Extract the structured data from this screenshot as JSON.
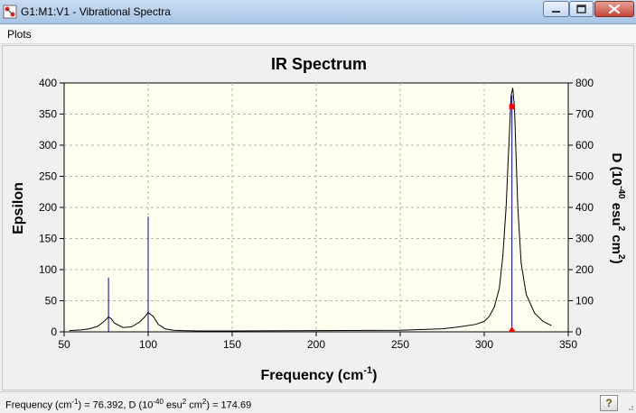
{
  "window": {
    "title": "G1:M1:V1 - Vibrational Spectra"
  },
  "menu": {
    "items": [
      "Plots"
    ]
  },
  "chart_data": {
    "type": "line",
    "title": "IR Spectrum",
    "xlabel_main": "Frequency (cm",
    "xlabel_sup": "-1",
    "xlabel_end": ")",
    "ylabel": "Epsilon",
    "y2label_parts": [
      "D (10",
      "-40",
      " esu",
      "2",
      " cm",
      "2",
      ")"
    ],
    "xlim": [
      50,
      350
    ],
    "ylim": [
      0,
      400
    ],
    "y2lim": [
      0,
      800
    ],
    "xticks": [
      50,
      100,
      150,
      200,
      250,
      300,
      350
    ],
    "yticks": [
      0,
      50,
      100,
      150,
      200,
      250,
      300,
      350,
      400
    ],
    "y2ticks": [
      0,
      100,
      200,
      300,
      400,
      500,
      600,
      700,
      800
    ],
    "grid": true,
    "series": [
      {
        "x": [
          53,
          60,
          65,
          70,
          73,
          75,
          76.4,
          78,
          80,
          85,
          90,
          95,
          98,
          100,
          103,
          106,
          110,
          115,
          120,
          130,
          150,
          200,
          250,
          275,
          285,
          295,
          300,
          303,
          306,
          309,
          311,
          313,
          314,
          315,
          316,
          317,
          318,
          319,
          320,
          322,
          325,
          330,
          335,
          340
        ],
        "y": [
          2,
          3,
          5,
          9,
          15,
          20,
          24,
          21,
          14,
          7,
          8,
          16,
          24,
          31,
          25,
          12,
          5,
          2.5,
          2,
          1.5,
          1.5,
          2,
          2.5,
          5,
          8,
          12,
          17,
          25,
          40,
          70,
          120,
          200,
          260,
          320,
          380,
          392,
          360,
          280,
          200,
          110,
          60,
          30,
          17,
          10
        ]
      }
    ],
    "sticks": [
      {
        "x": 76.4,
        "D": 174.69
      },
      {
        "x": 100,
        "D": 370
      },
      {
        "x": 316.5,
        "D": 760
      }
    ],
    "marker": {
      "x": 316.5,
      "y": 362
    },
    "colors": {
      "curve": "#000000",
      "sticks": "#0000aa",
      "marker": "#ff0000",
      "plot_bg": "#fffff0",
      "grid": "#b4b4b4"
    }
  },
  "status": {
    "parts": [
      "Frequency (cm",
      "-1",
      ") = 76.392, D (10",
      "-40",
      " esu",
      "2",
      " cm",
      "2",
      ") = 174.69"
    ]
  },
  "help_button": {
    "label": "?"
  }
}
